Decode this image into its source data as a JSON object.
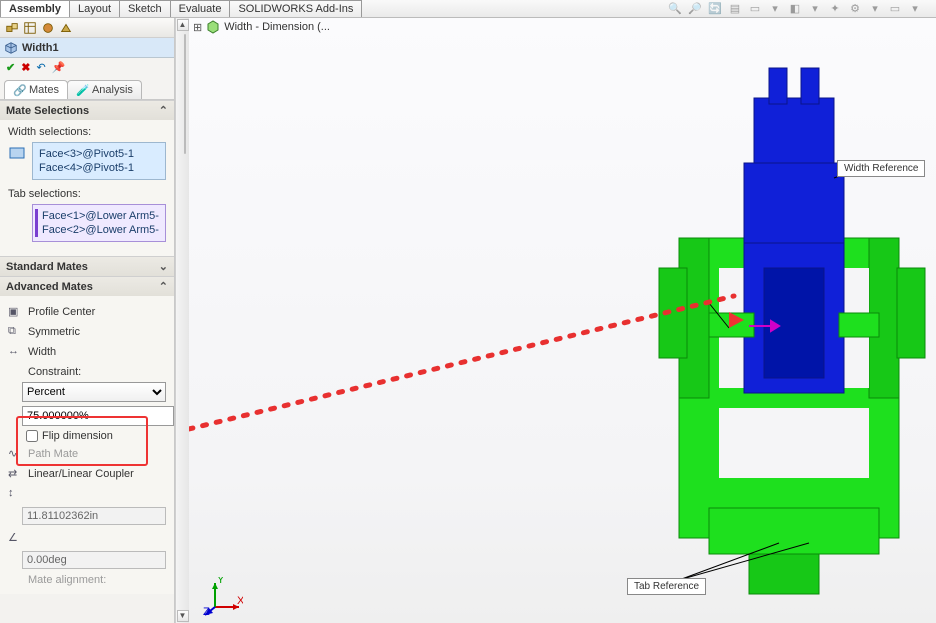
{
  "top_tabs": {
    "assembly": "Assembly",
    "layout": "Layout",
    "sketch": "Sketch",
    "evaluate": "Evaluate",
    "addins": "SOLIDWORKS Add-Ins"
  },
  "feature_name": "Width1",
  "breadcrumb": "Width - Dimension  (...",
  "subtabs": {
    "mates": "Mates",
    "analysis": "Analysis"
  },
  "mate_selections": {
    "header": "Mate Selections",
    "width_label": "Width selections:",
    "width_items": [
      "Face<3>@Pivot5-1",
      "Face<4>@Pivot5-1"
    ],
    "tab_label": "Tab selections:",
    "tab_items": [
      "Face<1>@Lower Arm5-",
      "Face<2>@Lower Arm5-"
    ]
  },
  "std_header": "Standard Mates",
  "adv": {
    "header": "Advanced Mates",
    "profile_center": "Profile Center",
    "symmetric": "Symmetric",
    "width": "Width",
    "constraint_label": "Constraint:",
    "constraint_value": "Percent",
    "percent_value": "75.000000%",
    "flip": "Flip dimension",
    "path_mate": "Path Mate",
    "linear_coupler": "Linear/Linear Coupler",
    "dist_value": "11.81102362in",
    "ang_value": "0.00deg",
    "mate_align": "Mate alignment:"
  },
  "callouts": {
    "width_ref": "Width Reference",
    "tab_ref": "Tab Reference"
  },
  "triad": {
    "x": "X",
    "y": "Y",
    "z": "Z"
  }
}
